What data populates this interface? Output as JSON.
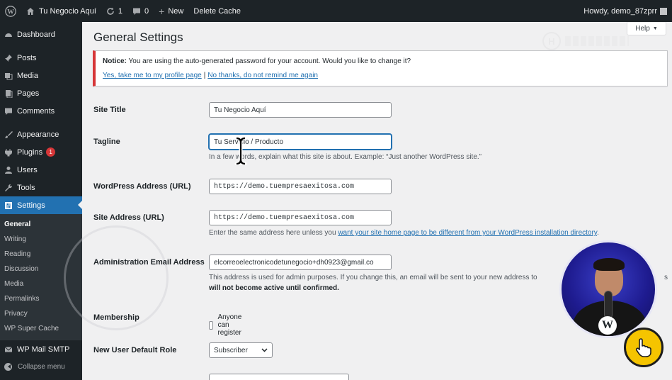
{
  "adminbar": {
    "site_name": "Tu Negocio Aquí",
    "updates_count": "1",
    "comments_count": "0",
    "new_label": "New",
    "delete_cache_label": "Delete Cache",
    "howdy_label": "Howdy, demo_87zprr"
  },
  "sidebar": {
    "items": [
      {
        "label": "Dashboard",
        "icon": "dashboard-icon"
      },
      {
        "label": "Posts",
        "icon": "pin-icon"
      },
      {
        "label": "Media",
        "icon": "media-icon"
      },
      {
        "label": "Pages",
        "icon": "pages-icon"
      },
      {
        "label": "Comments",
        "icon": "comment-icon"
      },
      {
        "label": "Appearance",
        "icon": "brush-icon"
      },
      {
        "label": "Plugins",
        "icon": "plugin-icon",
        "badge": "1"
      },
      {
        "label": "Users",
        "icon": "user-icon"
      },
      {
        "label": "Tools",
        "icon": "wrench-icon"
      },
      {
        "label": "Settings",
        "icon": "settings-icon"
      }
    ],
    "submenu": [
      "General",
      "Writing",
      "Reading",
      "Discussion",
      "Media",
      "Permalinks",
      "Privacy",
      "WP Super Cache"
    ],
    "after": {
      "label": "WP Mail SMTP",
      "icon": "mail-icon"
    },
    "collapse_label": "Collapse menu"
  },
  "page": {
    "title": "General Settings",
    "help_label": "Help"
  },
  "notice": {
    "prefix": "Notice:",
    "message": "You are using the auto-generated password for your account. Would you like to change it?",
    "link_yes": "Yes, take me to my profile page",
    "separator": "|",
    "link_no": "No thanks, do not remind me again"
  },
  "form": {
    "site_title_label": "Site Title",
    "site_title_value": "Tu Negocio Aquí",
    "tagline_label": "Tagline",
    "tagline_value": "Tu Servicio / Producto",
    "tagline_desc": "In a few words, explain what this site is about. Example: “Just another WordPress site.”",
    "wp_address_label": "WordPress Address (URL)",
    "wp_address_value": "https://demo.tuempresaexitosa.com",
    "site_address_label": "Site Address (URL)",
    "site_address_value": "https://demo.tuempresaexitosa.com",
    "site_address_desc_prefix": "Enter the same address here unless you",
    "site_address_desc_link": "want your site home page to be different from your WordPress installation directory",
    "site_address_desc_suffix": ".",
    "admin_email_label": "Administration Email Address",
    "admin_email_value": "elcorreoelectronicodetunegocio+dh0923@gmail.co",
    "admin_email_desc": "This address is used for admin purposes. If you change this, an email will be sent to your new address to",
    "admin_email_desc_suffix": "s",
    "admin_email_desc_bold": "will not become active until confirmed.",
    "membership_label": "Membership",
    "membership_checkbox": "Anyone can register",
    "default_role_label": "New User Default Role",
    "default_role_value": "Subscriber"
  },
  "colors": {
    "adminbar_bg": "#1d2327",
    "accent": "#2271b1",
    "notice_border": "#d63638",
    "badge": "#d63638"
  }
}
